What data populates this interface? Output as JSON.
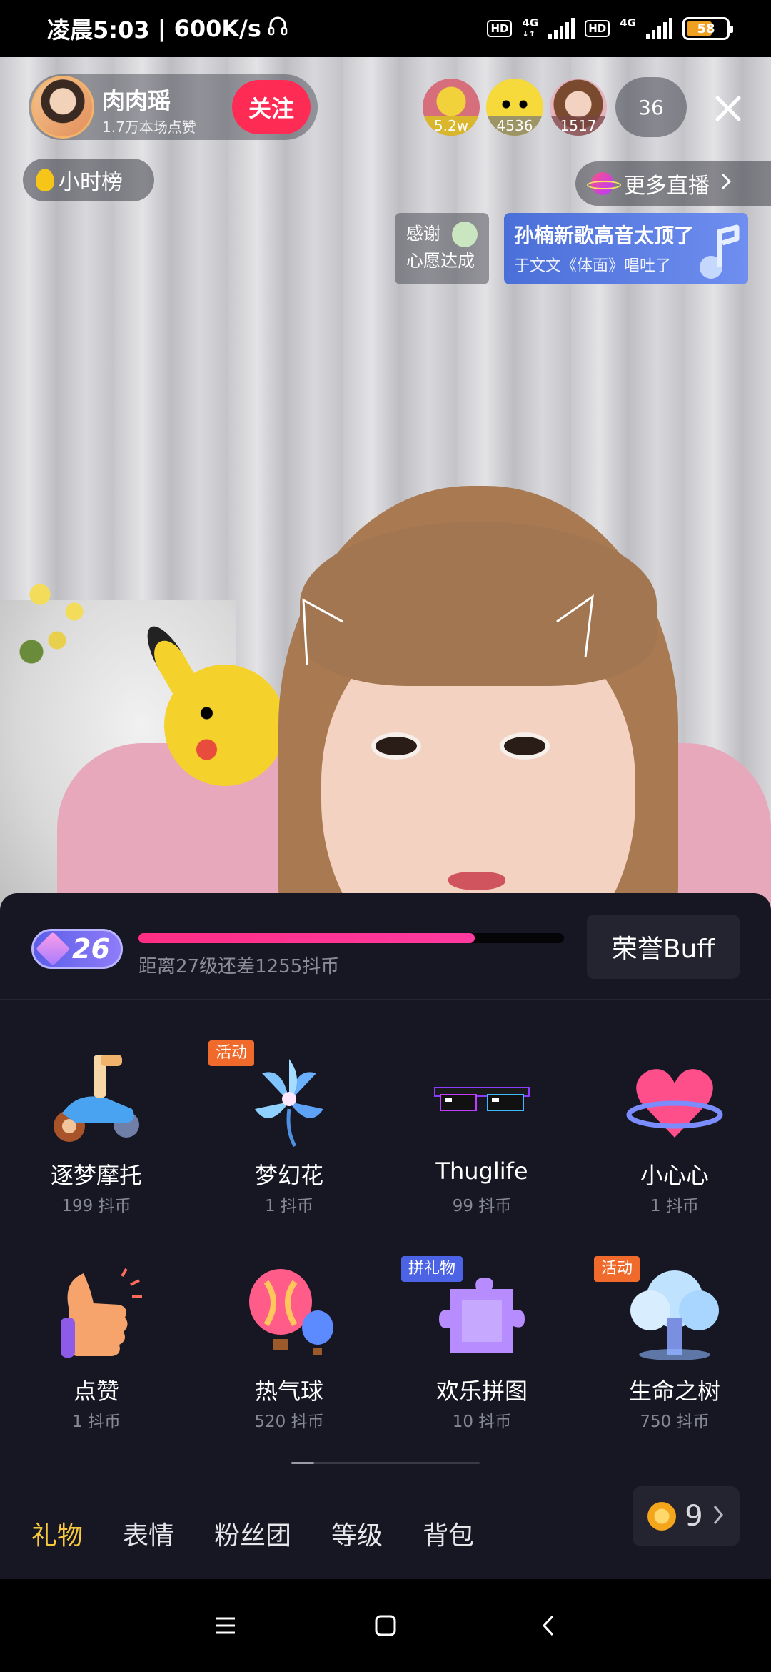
{
  "status_bar": {
    "time": "凌晨5:03",
    "speed": "600K/s",
    "hd1": "HD",
    "net1": "4G",
    "hd2": "HD",
    "net2": "4G",
    "battery": "58"
  },
  "header": {
    "anchor_name": "肉肉瑶",
    "anchor_likes": "1.7万本场点赞",
    "follow_label": "关注",
    "top_viewers": [
      {
        "count": "5.2w"
      },
      {
        "count": "4536"
      },
      {
        "count": "1517"
      }
    ],
    "online_count": "36"
  },
  "overlay": {
    "hour_rank_label": "小时榜",
    "more_live_label": "更多直播",
    "thanks_line1": "感谢",
    "thanks_line2": "心愿达成",
    "song_title": "孙楠新歌高音太顶了",
    "song_subtitle": "于文文《体面》唱吐了"
  },
  "gift_panel": {
    "level": "26",
    "level_progress": 0.79,
    "level_progress_text": "距离27级还差1255抖币",
    "honor_buff_label": "荣誉Buff",
    "gifts": [
      {
        "name": "逐梦摩托",
        "price": "199 抖币",
        "tag": ""
      },
      {
        "name": "梦幻花",
        "price": "1 抖币",
        "tag": "活动"
      },
      {
        "name": "Thuglife",
        "price": "99 抖币",
        "tag": ""
      },
      {
        "name": "小心心",
        "price": "1 抖币",
        "tag": ""
      },
      {
        "name": "点赞",
        "price": "1 抖币",
        "tag": ""
      },
      {
        "name": "热气球",
        "price": "520 抖币",
        "tag": ""
      },
      {
        "name": "欢乐拼图",
        "price": "10 抖币",
        "tag": "拼礼物"
      },
      {
        "name": "生命之树",
        "price": "750 抖币",
        "tag": "活动"
      }
    ],
    "tabs": [
      {
        "label": "礼物",
        "active": true
      },
      {
        "label": "表情",
        "active": false
      },
      {
        "label": "粉丝团",
        "active": false
      },
      {
        "label": "等级",
        "active": false
      },
      {
        "label": "背包",
        "active": false
      }
    ],
    "coin_balance": "9"
  },
  "colors": {
    "accent_pink": "#fe2c55",
    "active_tab": "#f7c83e",
    "panel_bg": "#161722"
  }
}
